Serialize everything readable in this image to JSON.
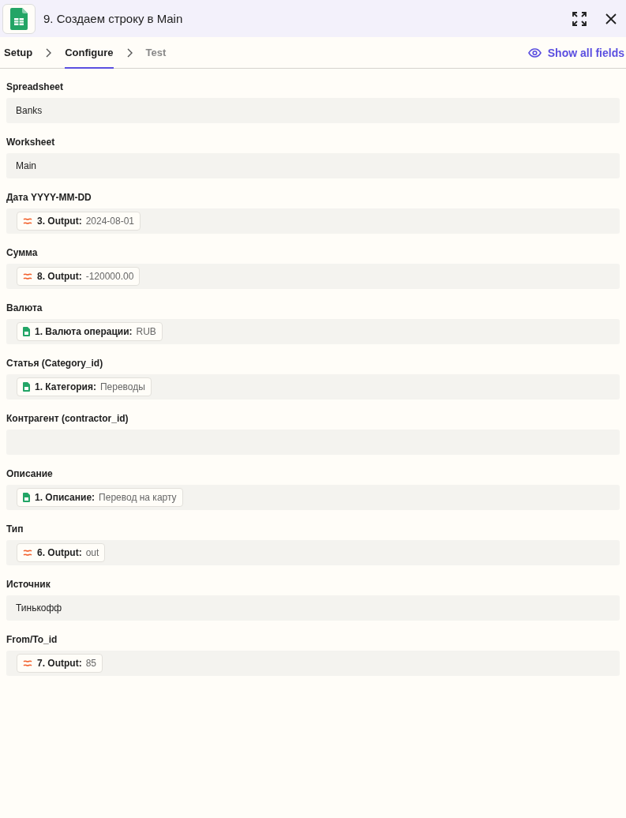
{
  "header": {
    "title": "9. Создаем строку в Main"
  },
  "steps": [
    {
      "label": "Setup",
      "selected": false,
      "disabled": false
    },
    {
      "label": "Configure",
      "selected": true,
      "disabled": false
    },
    {
      "label": "Test",
      "selected": false,
      "disabled": true
    }
  ],
  "show_all_fields": "Show all fields",
  "fields": [
    {
      "label": "Spreadsheet",
      "value": "Banks"
    },
    {
      "label": "Worksheet",
      "value": "Main"
    },
    {
      "label": "Дата YYYY-MM-DD",
      "pills": [
        {
          "kind": "formatter",
          "name": "3. Output:",
          "value": "2024-08-01"
        }
      ]
    },
    {
      "label": "Сумма",
      "pills": [
        {
          "kind": "formatter",
          "name": "8. Output:",
          "value": "-120000.00"
        }
      ]
    },
    {
      "label": "Валюта",
      "pills": [
        {
          "kind": "sheets",
          "name": "1. Валюта операции:",
          "value": "RUB"
        }
      ]
    },
    {
      "label": "Статья (Category_id)",
      "pills": [
        {
          "kind": "sheets",
          "name": "1. Категория:",
          "value": "Переводы"
        }
      ]
    },
    {
      "label": "Контрагент (contractor_id)"
    },
    {
      "label": "Описание",
      "pills": [
        {
          "kind": "sheets",
          "name": "1. Описание:",
          "value": "Перевод на карту"
        }
      ]
    },
    {
      "label": "Тип",
      "pills": [
        {
          "kind": "formatter",
          "name": "6. Output:",
          "value": "out"
        }
      ]
    },
    {
      "label": "Источник",
      "value": "Тинькофф"
    },
    {
      "label": "From/To_id",
      "pills": [
        {
          "kind": "formatter",
          "name": "7. Output:",
          "value": "85"
        }
      ]
    }
  ]
}
